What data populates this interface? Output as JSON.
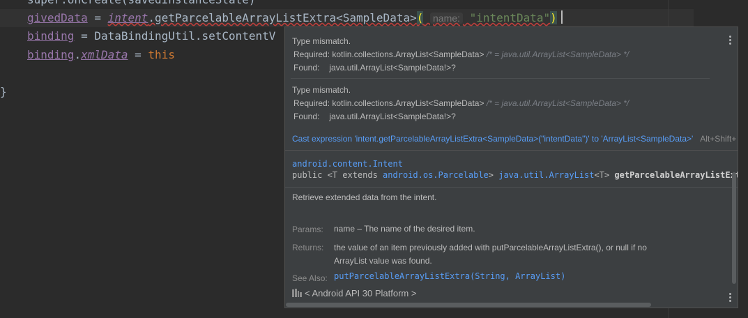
{
  "editor": {
    "line0": "super.onCreate(savedInstanceState)",
    "line1": {
      "var": "givedData",
      "eq": " = ",
      "intent": "intent",
      "call": ".getParcelableArrayListExtra<SampleData>",
      "open_paren": "(",
      "hint": "name:",
      "arg": "\"intentData\"",
      "close_paren": ")"
    },
    "line2": {
      "var": "binding",
      "rest": " = DataBindingUtil.setContentV"
    },
    "line3": {
      "var": "binding",
      "dot": ".",
      "prop": "xmlData",
      "eq": " = ",
      "kw": "this"
    },
    "line5": "}"
  },
  "popup": {
    "error1": {
      "title": "Type mismatch.",
      "required_label": "Required:",
      "required_value": "kotlin.collections.ArrayList<SampleData>",
      "required_comment": "/* = java.util.ArrayList<SampleData> */",
      "found_label": "Found:",
      "found_value": "java.util.ArrayList<SampleData!>?"
    },
    "error2": {
      "title": "Type mismatch.",
      "required_label": "Required:",
      "required_value": "kotlin.collections.ArrayList<SampleData>",
      "required_comment": "/* = java.util.ArrayList<SampleData> */",
      "found_label": "Found:",
      "found_value": "java.util.ArrayList<SampleData!>?"
    },
    "quickfix": {
      "label": "Cast expression 'intent.getParcelableArrayListExtra<SampleData>(\"intentData\")' to 'ArrayList<SampleData>'",
      "shortcut": "Alt+Shift+"
    },
    "doc": {
      "class_name": "android.content.Intent",
      "sig_public": "public <T extends ",
      "sig_parcelable": "android.os.Parcelable",
      "sig_gt": "> ",
      "sig_return": "java.util.ArrayList",
      "sig_t": "<T> ",
      "sig_method": "getParcelableArrayListExtra(",
      "description": "Retrieve extended data from the intent.",
      "params_label": "Params:",
      "params_value": "name – The name of the desired item.",
      "returns_label": "Returns:",
      "returns_line1": "the value of an item previously added with putParcelableArrayListExtra(), or null if no",
      "returns_line2": "ArrayList value was found.",
      "see_also_label": "See Also:",
      "see_also_link": "putParcelableArrayListExtra(String, ArrayList)",
      "library": "< Android API 30 Platform >"
    }
  },
  "colors": {
    "editor_bg": "#2b2b2b",
    "popup_bg": "#3c3f41",
    "link": "#589df6",
    "error_underline": "#bc3f3c"
  }
}
